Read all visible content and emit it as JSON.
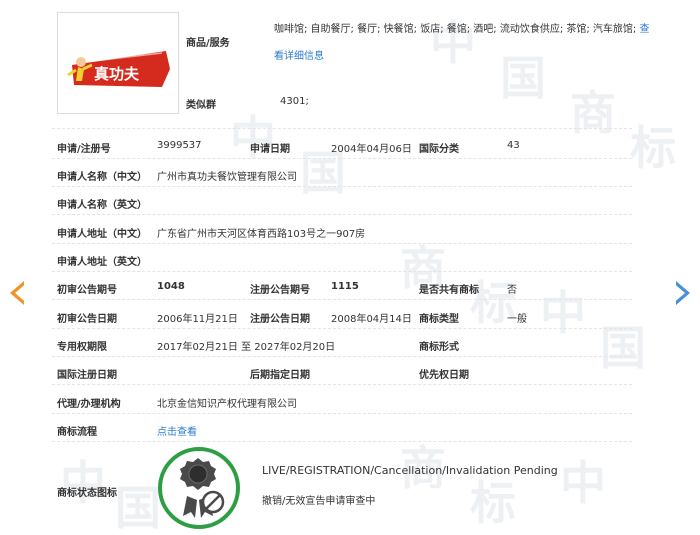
{
  "logo": {
    "text": "真功夫"
  },
  "goods_services": {
    "label": "商品/服务",
    "value": "咖啡馆; 自助餐厅; 餐厅; 快餐馆; 饭店; 餐馆; 酒吧; 流动饮食供应; 茶馆; 汽车旅馆;",
    "link_part1": "查",
    "link_part2": "看详细信息"
  },
  "similar_group": {
    "label": "类似群",
    "value": "4301;"
  },
  "fields": {
    "reg_no_label": "申请/注册号",
    "reg_no": "3999537",
    "app_date_label": "申请日期",
    "app_date": "2004年04月06日",
    "intl_class_label": "国际分类",
    "intl_class": "43",
    "applicant_cn_label": "申请人名称（中文）",
    "applicant_cn": "广州市真功夫餐饮管理有限公司",
    "applicant_en_label": "申请人名称（英文）",
    "address_cn_label": "申请人地址（中文）",
    "address_cn": "广东省广州市天河区体育西路103号之一907房",
    "address_en_label": "申请人地址（英文）",
    "prelim_no_label": "初审公告期号",
    "prelim_no": "1048",
    "reg_pub_no_label": "注册公告期号",
    "reg_pub_no": "1115",
    "shared_label": "是否共有商标",
    "shared": "否",
    "prelim_date_label": "初审公告日期",
    "prelim_date": "2006年11月21日",
    "reg_pub_date_label": "注册公告日期",
    "reg_pub_date": "2008年04月14日",
    "tm_type_label": "商标类型",
    "tm_type": "一般",
    "exclusive_label": "专用权期限",
    "exclusive": "2017年02月21日 至 2027年02月20日",
    "tm_form_label": "商标形式",
    "intl_reg_date_label": "国际注册日期",
    "later_date_label": "后期指定日期",
    "priority_date_label": "优先权日期",
    "agent_label": "代理/办理机构",
    "agent": "北京金信知识产权代理有限公司",
    "flow_label": "商标流程",
    "flow_link": "点击查看",
    "status_label": "商标状态图标"
  },
  "status": {
    "en": "LIVE/REGISTRATION/Cancellation/Invalidation Pending",
    "cn": "撤销/无效宣告申请审查中"
  },
  "watermark": {
    "char1": "中",
    "char2": "国",
    "char3": "商",
    "char4": "标"
  },
  "colors": {
    "accent_link": "#2b7ac9",
    "status_green": "#2e9e44",
    "arrow_left": "#f0932b",
    "arrow_right": "#4a90d9"
  }
}
